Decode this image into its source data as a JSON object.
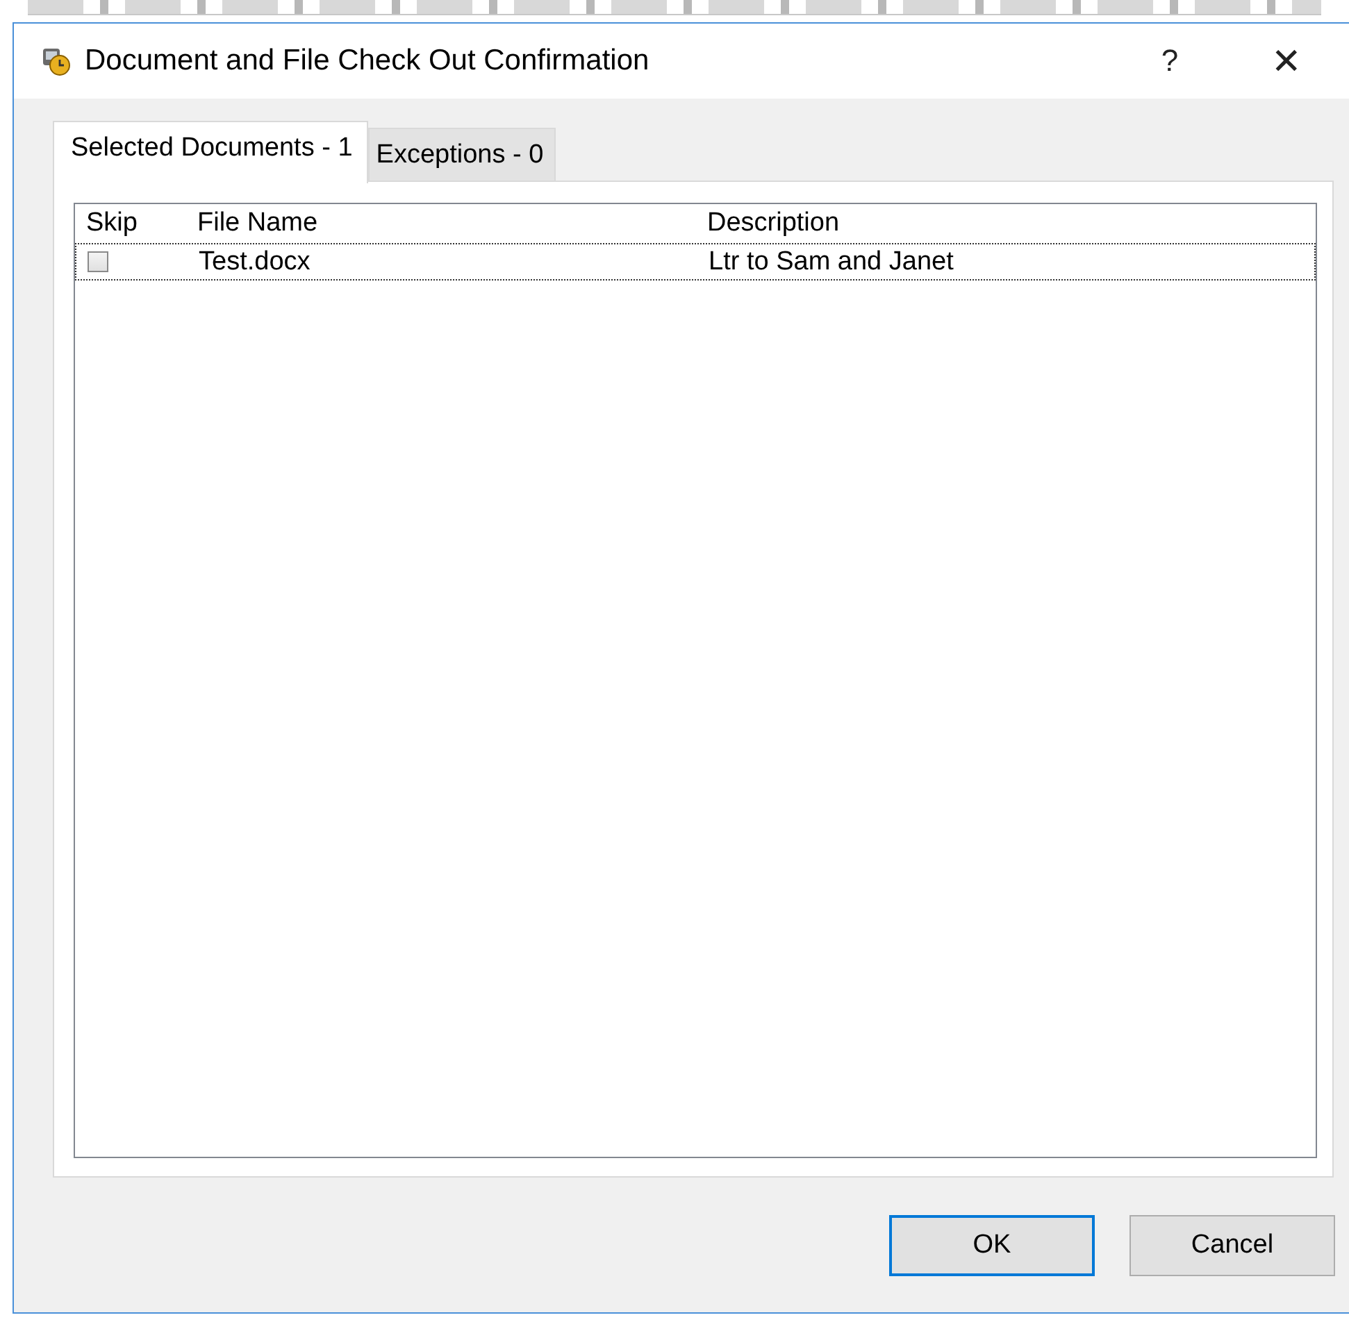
{
  "window": {
    "title": "Document and File Check Out Confirmation",
    "help": "?",
    "close": "✕"
  },
  "tabs": [
    {
      "label": "Selected Documents - 1",
      "selected": true
    },
    {
      "label": "Exceptions - 0",
      "selected": false
    }
  ],
  "table": {
    "columns": [
      "Skip",
      "File Name",
      "Description"
    ],
    "rows": [
      {
        "skip": false,
        "file_name": "Test.docx",
        "description": "Ltr to Sam and Janet",
        "focused": true
      }
    ]
  },
  "buttons": [
    {
      "label": "OK",
      "default": true
    },
    {
      "label": "Cancel",
      "default": false
    }
  ]
}
